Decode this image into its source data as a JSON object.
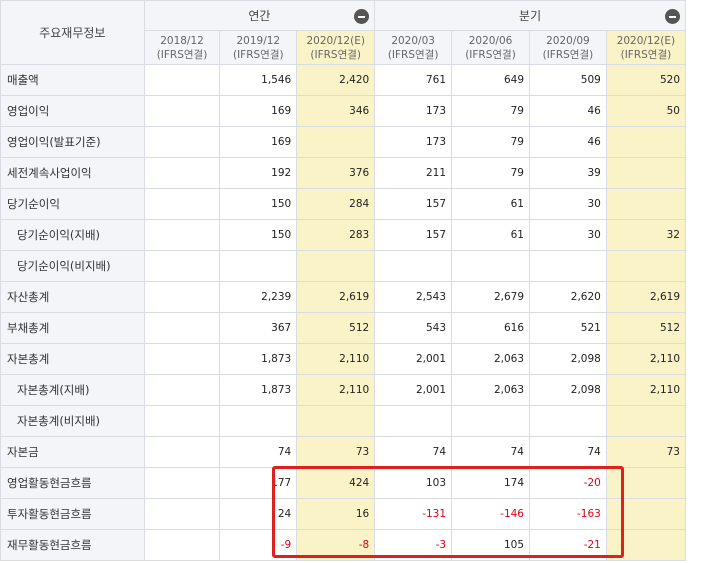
{
  "header": {
    "corner": "주요재무정보",
    "annual": "연간",
    "quarterly": "분기"
  },
  "periods": [
    {
      "date": "2018/12",
      "basis": "(IFRS연결)",
      "estimate": false
    },
    {
      "date": "2019/12",
      "basis": "(IFRS연결)",
      "estimate": false
    },
    {
      "date": "2020/12(E)",
      "basis": "(IFRS연결)",
      "estimate": true
    },
    {
      "date": "2020/03",
      "basis": "(IFRS연결)",
      "estimate": false
    },
    {
      "date": "2020/06",
      "basis": "(IFRS연결)",
      "estimate": false
    },
    {
      "date": "2020/09",
      "basis": "(IFRS연결)",
      "estimate": false
    },
    {
      "date": "2020/12(E)",
      "basis": "(IFRS연결)",
      "estimate": true
    }
  ],
  "rows": [
    {
      "label": "매출액",
      "sub": false,
      "values": [
        "",
        "1,546",
        "2,420",
        "761",
        "649",
        "509",
        "520"
      ]
    },
    {
      "label": "영업이익",
      "sub": false,
      "values": [
        "",
        "169",
        "346",
        "173",
        "79",
        "46",
        "50"
      ]
    },
    {
      "label": "영업이익(발표기준)",
      "sub": false,
      "values": [
        "",
        "169",
        "",
        "173",
        "79",
        "46",
        ""
      ]
    },
    {
      "label": "세전계속사업이익",
      "sub": false,
      "values": [
        "",
        "192",
        "376",
        "211",
        "79",
        "39",
        ""
      ]
    },
    {
      "label": "당기순이익",
      "sub": false,
      "values": [
        "",
        "150",
        "284",
        "157",
        "61",
        "30",
        ""
      ]
    },
    {
      "label": "당기순이익(지배)",
      "sub": true,
      "values": [
        "",
        "150",
        "283",
        "157",
        "61",
        "30",
        "32"
      ]
    },
    {
      "label": "당기순이익(비지배)",
      "sub": true,
      "values": [
        "",
        "",
        "",
        "",
        "",
        "",
        ""
      ]
    },
    {
      "label": "자산총계",
      "sub": false,
      "values": [
        "",
        "2,239",
        "2,619",
        "2,543",
        "2,679",
        "2,620",
        "2,619"
      ]
    },
    {
      "label": "부채총계",
      "sub": false,
      "values": [
        "",
        "367",
        "512",
        "543",
        "616",
        "521",
        "512"
      ]
    },
    {
      "label": "자본총계",
      "sub": false,
      "values": [
        "",
        "1,873",
        "2,110",
        "2,001",
        "2,063",
        "2,098",
        "2,110"
      ]
    },
    {
      "label": "자본총계(지배)",
      "sub": true,
      "values": [
        "",
        "1,873",
        "2,110",
        "2,001",
        "2,063",
        "2,098",
        "2,110"
      ]
    },
    {
      "label": "자본총계(비지배)",
      "sub": true,
      "values": [
        "",
        "",
        "",
        "",
        "",
        "",
        ""
      ]
    },
    {
      "label": "자본금",
      "sub": false,
      "values": [
        "",
        "74",
        "73",
        "74",
        "74",
        "74",
        "73"
      ]
    },
    {
      "label": "영업활동현금흐름",
      "sub": false,
      "values": [
        "",
        "177",
        "424",
        "103",
        "174",
        "-20",
        ""
      ]
    },
    {
      "label": "투자활동현금흐름",
      "sub": false,
      "values": [
        "",
        "24",
        "16",
        "-131",
        "-146",
        "-163",
        ""
      ]
    },
    {
      "label": "재무활동현금흐름",
      "sub": false,
      "values": [
        "",
        "-9",
        "-8",
        "-3",
        "105",
        "-21",
        ""
      ]
    }
  ],
  "colors": {
    "header_bg": "#f3f5f9",
    "estimate_bg": "#fbf3c8",
    "negative": "#e0001b",
    "highlight_border": "#e02020"
  }
}
